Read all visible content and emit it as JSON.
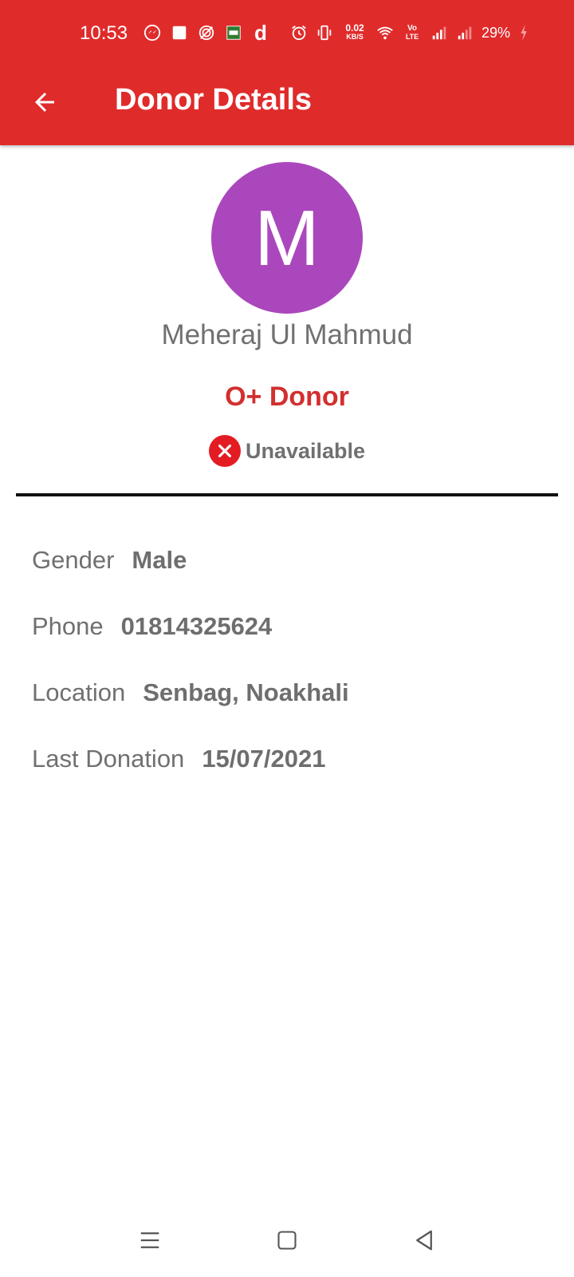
{
  "status_bar": {
    "time": "10:53",
    "net_speed_value": "0.02",
    "net_speed_unit": "KB/S",
    "volte_top": "Vo",
    "volte_bottom": "LTE",
    "battery": "29%",
    "d_glyph": "d",
    "icons": [
      "messenger-icon",
      "square-app-icon",
      "vpn-icon",
      "image-app-icon",
      "d-app-icon",
      "alarm-icon",
      "vibrate-icon",
      "wifi-icon",
      "signal-icon",
      "signal-icon-2",
      "charging-icon"
    ]
  },
  "app_bar": {
    "title": "Donor Details",
    "back_icon": "arrow-back-icon",
    "color": "#e02b2b"
  },
  "profile": {
    "avatar_letter": "M",
    "avatar_color": "#ab47bc",
    "name": "Meheraj Ul Mahmud",
    "blood_group": "O+ Donor",
    "availability": "Unavailable",
    "availability_icon": "close-circle-icon"
  },
  "details": [
    {
      "label": "Gender",
      "value": "Male"
    },
    {
      "label": "Phone",
      "value": "01814325624"
    },
    {
      "label": "Location",
      "value": "Senbag, Noakhali"
    },
    {
      "label": "Last Donation",
      "value": "15/07/2021"
    }
  ],
  "nav_bar": {
    "icons": [
      "menu-icon",
      "home-square-icon",
      "back-triangle-icon"
    ]
  }
}
